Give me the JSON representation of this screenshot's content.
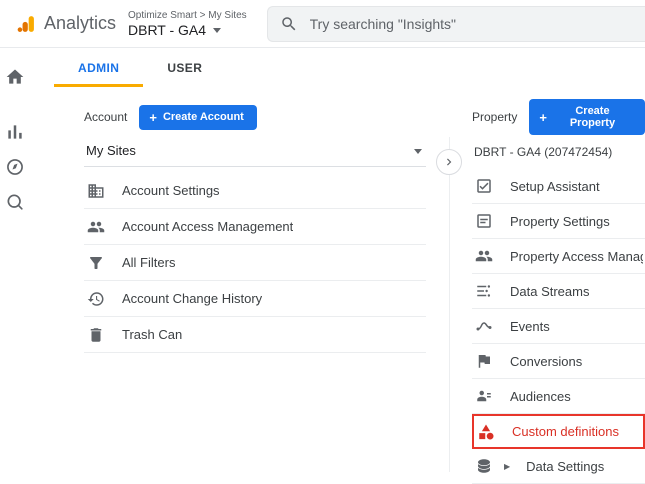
{
  "topbar": {
    "app_name": "Analytics",
    "breadcrumb": "Optimize Smart > My Sites",
    "account_name": "DBRT - GA4",
    "search_placeholder": "Try searching \"Insights\""
  },
  "tabs": {
    "admin": "ADMIN",
    "user": "USER"
  },
  "account": {
    "label": "Account",
    "create_label": "Create Account",
    "selector": "My Sites",
    "items": [
      {
        "label": "Account Settings",
        "icon": "domain-icon"
      },
      {
        "label": "Account Access Management",
        "icon": "people-icon"
      },
      {
        "label": "All Filters",
        "icon": "filter-icon"
      },
      {
        "label": "Account Change History",
        "icon": "history-icon"
      },
      {
        "label": "Trash Can",
        "icon": "trash-icon"
      }
    ]
  },
  "property": {
    "label": "Property",
    "create_label": "Create Property",
    "selector": "DBRT - GA4 (207472454)",
    "items": [
      {
        "label": "Setup Assistant",
        "icon": "setup-assistant-icon"
      },
      {
        "label": "Property Settings",
        "icon": "property-settings-icon"
      },
      {
        "label": "Property Access Management",
        "icon": "people-icon"
      },
      {
        "label": "Data Streams",
        "icon": "data-streams-icon"
      },
      {
        "label": "Events",
        "icon": "events-icon"
      },
      {
        "label": "Conversions",
        "icon": "flag-icon"
      },
      {
        "label": "Audiences",
        "icon": "audiences-icon"
      },
      {
        "label": "Custom definitions",
        "icon": "custom-definitions-icon",
        "highlighted": true
      },
      {
        "label": "Data Settings",
        "icon": "data-settings-icon",
        "expandable": true
      }
    ]
  },
  "sidebar": {
    "icons": [
      "home-icon",
      "reports-icon",
      "explore-icon",
      "advertising-icon"
    ]
  },
  "colors": {
    "accent_blue": "#1a73e8",
    "brand_orange": "#f9ab00",
    "brand_orange_dark": "#e37400",
    "highlight_red": "#e8352a",
    "highlight_text_red": "#d93025",
    "icon_gray": "#5f6368",
    "search_bg": "#f1f3f4"
  }
}
